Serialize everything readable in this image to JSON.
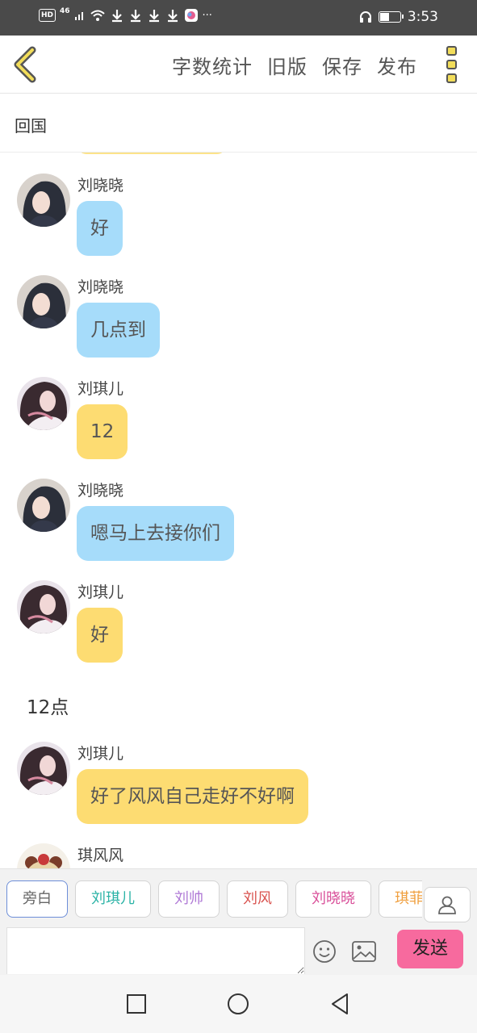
{
  "status_bar": {
    "hd": "HD",
    "network": "46",
    "ellipsis": "···",
    "time": "3:53",
    "battery_level": 0.45
  },
  "header": {
    "back_icon": "chevron-left-icon",
    "actions": [
      "字数统计",
      "旧版",
      "保存",
      "发布"
    ],
    "more_icon": "vertical-dots-menu-icon"
  },
  "title": "回国",
  "messages": [
    {
      "sender": "刘晓晓",
      "text": "好",
      "side": "blue"
    },
    {
      "sender": "刘晓晓",
      "text": "几点到",
      "side": "blue"
    },
    {
      "sender": "刘琪儿",
      "text": "12",
      "side": "yellow"
    },
    {
      "sender": "刘晓晓",
      "text": "嗯马上去接你们",
      "side": "blue"
    },
    {
      "sender": "刘琪儿",
      "text": "好",
      "side": "yellow"
    }
  ],
  "narration": "12点",
  "messages_after": [
    {
      "sender": "刘琪儿",
      "text": "好了风风自己走好不好啊",
      "side": "yellow"
    },
    {
      "sender": "琪风风",
      "text": "",
      "side": "blue"
    }
  ],
  "composer": {
    "roles": [
      {
        "name": "旁白",
        "color": "#666666",
        "selected": true
      },
      {
        "name": "刘琪儿",
        "color": "#2bb3a6",
        "selected": false
      },
      {
        "name": "刘帅",
        "color": "#b07ad6",
        "selected": false
      },
      {
        "name": "刘风",
        "color": "#d9534f",
        "selected": false
      },
      {
        "name": "刘晓晓",
        "color": "#d9509a",
        "selected": false
      },
      {
        "name": "琪菲",
        "color": "#f0a040",
        "selected": false
      }
    ],
    "input_value": "",
    "send_label": "发送",
    "icons": [
      "person-icon",
      "emoji-icon",
      "image-icon"
    ]
  },
  "colors": {
    "blue_bubble": "#a6dcfa",
    "yellow_bubble": "#fddc72",
    "send_button": "#f76a9e",
    "accent": "#f2dd5a"
  }
}
